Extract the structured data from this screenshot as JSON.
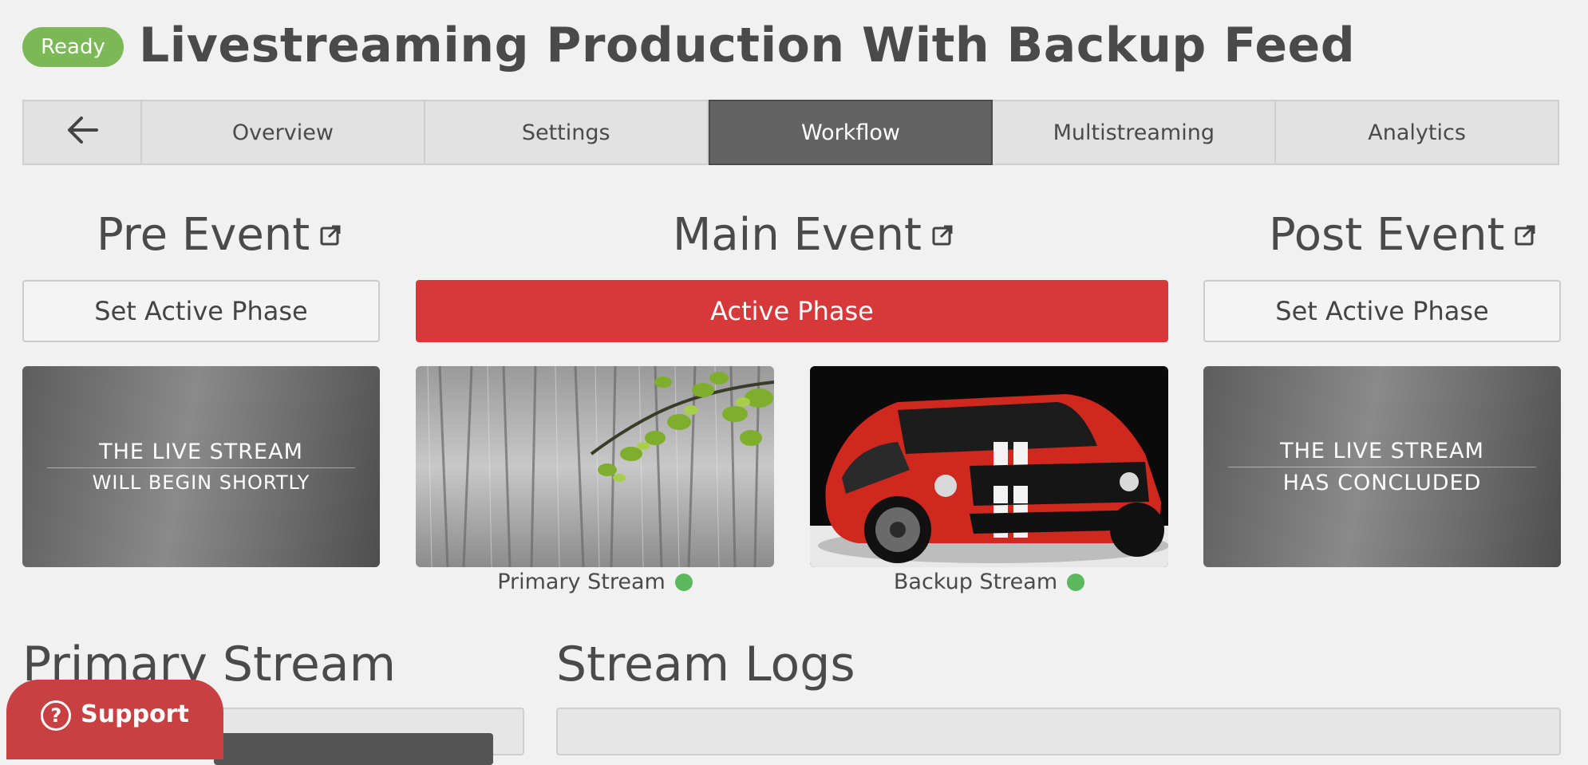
{
  "header": {
    "status_badge": "Ready",
    "title": "Livestreaming Production With Backup Feed"
  },
  "tabs": [
    {
      "label": ""
    },
    {
      "label": "Overview"
    },
    {
      "label": "Settings"
    },
    {
      "label": "Workflow",
      "active": true
    },
    {
      "label": "Multistreaming"
    },
    {
      "label": "Analytics"
    }
  ],
  "phases": {
    "pre": {
      "title": "Pre Event",
      "button": "Set Active Phase",
      "slate_line1": "THE LIVE STREAM",
      "slate_line2": "WILL BEGIN SHORTLY"
    },
    "main": {
      "title": "Main Event",
      "button": "Active Phase"
    },
    "post": {
      "title": "Post Event",
      "button": "Set Active Phase",
      "slate_line1": "THE LIVE STREAM",
      "slate_line2": "HAS CONCLUDED"
    }
  },
  "streams": {
    "primary_label": "Primary Stream",
    "backup_label": "Backup Stream",
    "primary_status_color": "#5cb85c",
    "backup_status_color": "#5cb85c"
  },
  "sections": {
    "primary_stream": "Primary Stream",
    "stream_logs": "Stream Logs"
  },
  "support": {
    "label": "Support",
    "icon": "question-circle-icon"
  },
  "colors": {
    "accent_red": "#d7393a",
    "ready_green": "#7bb956",
    "active_tab": "#636363"
  }
}
